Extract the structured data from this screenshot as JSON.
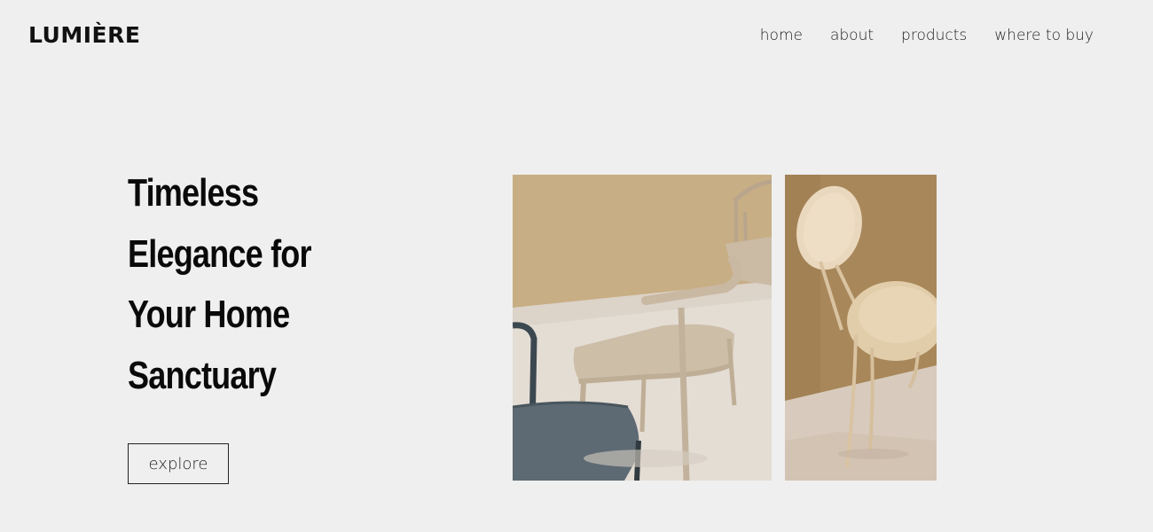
{
  "header": {
    "brand": "LUMIÈRE",
    "nav": [
      "home",
      "about",
      "products",
      "where to buy"
    ]
  },
  "hero": {
    "headline_lines": [
      "Timeless",
      "Elegance for",
      "Your Home",
      "Sanctuary"
    ],
    "cta_label": "explore"
  },
  "images": {
    "main": {
      "subject": "chairs-photo"
    },
    "side": {
      "subject": "chair-photo"
    }
  },
  "colors": {
    "background": "#efefef",
    "text": "#111111",
    "wall_beige": "#c7ad82",
    "floor": "#e3dbd2",
    "chair_frame": "#c9b8a2",
    "seat_gray": "#5d6a73"
  }
}
